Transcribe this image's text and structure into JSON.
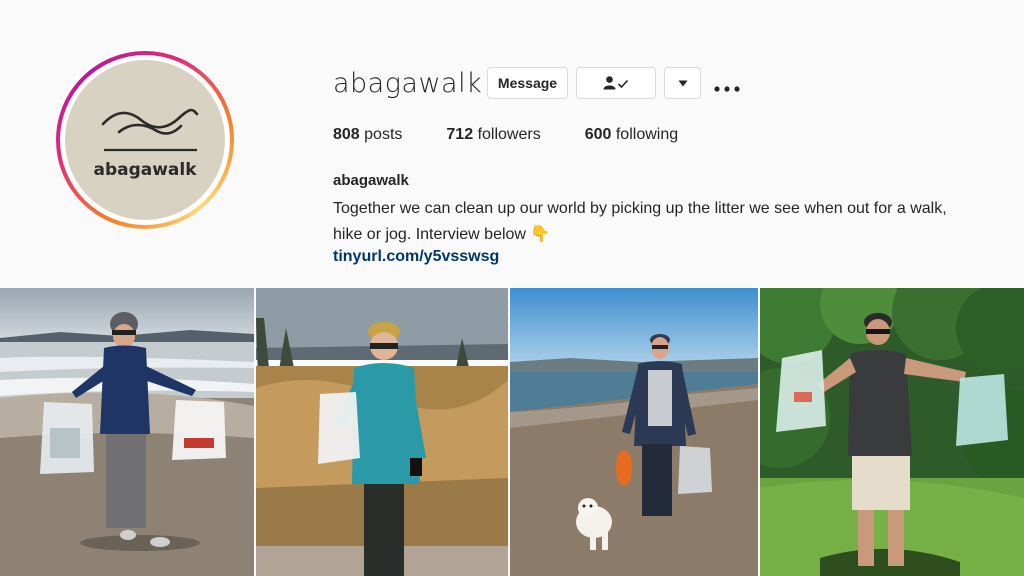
{
  "profile": {
    "username": "abagawalk",
    "avatar_text": "abagawalk",
    "message_label": "Message",
    "follow_icon": "user-check-icon",
    "dropdown_icon": "chevron-down-icon",
    "more_icon": "more-icon"
  },
  "stats": {
    "posts_count": "808",
    "posts_label": "posts",
    "followers_count": "712",
    "followers_label": "followers",
    "following_count": "600",
    "following_label": "following"
  },
  "bio": {
    "name": "abagawalk",
    "text": "Together we can clean up our world by picking up the litter we see when out for a walk, hike or jog. Interview below 👇",
    "link": "tinyurl.com/y5vsswsg"
  },
  "posts": [
    {
      "scene": "beach-winter"
    },
    {
      "scene": "grass-field"
    },
    {
      "scene": "beach-dog"
    },
    {
      "scene": "forest-trail"
    }
  ],
  "colors": {
    "background": "#fafafa",
    "link": "#00376b",
    "avatar_bg": "#d8d2c2",
    "button_border": "#dbdbdb"
  }
}
